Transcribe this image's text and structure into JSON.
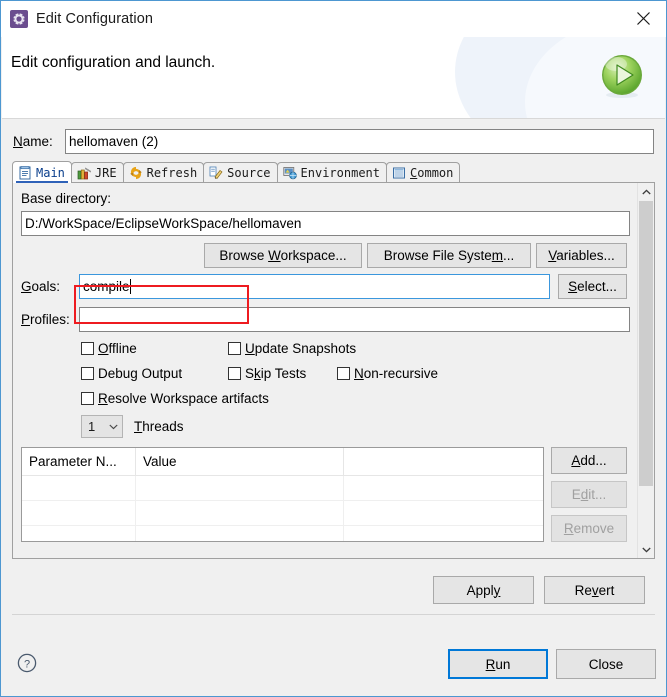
{
  "window": {
    "title": "Edit Configuration",
    "title_icon": "gear-icon",
    "close_icon": "close-icon"
  },
  "header": {
    "message": "Edit configuration and launch.",
    "icon": "run-play-icon"
  },
  "name_field": {
    "label_pre": "N",
    "label_acc": "N",
    "label": "Name:",
    "value": "hellomaven (2)"
  },
  "tabs": [
    {
      "label": "Main",
      "icon": "document-icon",
      "selected": true
    },
    {
      "label": "JRE",
      "icon": "books-icon",
      "selected": false
    },
    {
      "label": "Refresh",
      "icon": "refresh-icon",
      "selected": false
    },
    {
      "label": "Source",
      "icon": "source-edit-icon",
      "selected": false
    },
    {
      "label": "Environment",
      "icon": "environment-icon",
      "selected": false
    },
    {
      "label": "Common",
      "icon": "common-grid-icon",
      "selected": false
    }
  ],
  "main_tab": {
    "base_directory": {
      "label": "Base directory:",
      "value": "D:/WorkSpace/EclipseWorkSpace/hellomaven",
      "buttons": [
        {
          "label": "Browse Workspace...",
          "accel": "W",
          "enabled": true
        },
        {
          "label": "Browse File System...",
          "accel": "m",
          "enabled": true
        },
        {
          "label": "Variables...",
          "accel": "V",
          "enabled": true
        }
      ]
    },
    "goals": {
      "label": "Goals:",
      "accel": "G",
      "value": "compile",
      "focused": true,
      "select_button": {
        "label": "Select...",
        "accel": "S"
      }
    },
    "profiles": {
      "label": "Profiles:",
      "accel": "P",
      "value": "",
      "placeholder": ""
    },
    "checkboxes": [
      {
        "label": "Offline",
        "accel": "O",
        "checked": false
      },
      {
        "label": "Update Snapshots",
        "accel": "U",
        "checked": false
      },
      {
        "label": "Debug Output",
        "accel": "g",
        "checked": false
      },
      {
        "label": "Skip Tests",
        "accel": "k",
        "checked": false
      },
      {
        "label": "Non-recursive",
        "accel": "N",
        "checked": false
      },
      {
        "label": "Resolve Workspace artifacts",
        "accel": "R",
        "checked": false
      }
    ],
    "threads": {
      "value": "1",
      "label": "Threads",
      "accel": "T",
      "chevron": "chevron-down-icon"
    },
    "parameters_table": {
      "columns": [
        "Parameter N...",
        "Value",
        ""
      ],
      "rows": [
        [
          "",
          "",
          ""
        ],
        [
          "",
          "",
          ""
        ],
        [
          "",
          "",
          ""
        ]
      ]
    },
    "table_buttons": [
      {
        "label": "Add...",
        "accel": "A",
        "enabled": true
      },
      {
        "label": "Edit...",
        "accel": "d",
        "enabled": false
      },
      {
        "label": "Remove",
        "accel": "R",
        "enabled": false
      }
    ]
  },
  "apply_bar": [
    {
      "label": "Apply",
      "accel": "y",
      "enabled": true
    },
    {
      "label": "Revert",
      "accel": "v",
      "enabled": true
    }
  ],
  "footer": {
    "help_icon": "help-question-icon",
    "buttons": [
      {
        "label": "Run",
        "accel": "R",
        "focused": true
      },
      {
        "label": "Close",
        "accel": "",
        "focused": false
      }
    ]
  },
  "scrollbar": {
    "up_icon": "chevron-up-icon",
    "down_icon": "chevron-down-icon"
  },
  "annotation": {
    "color": "#ee1b20",
    "target": "goals-input"
  }
}
